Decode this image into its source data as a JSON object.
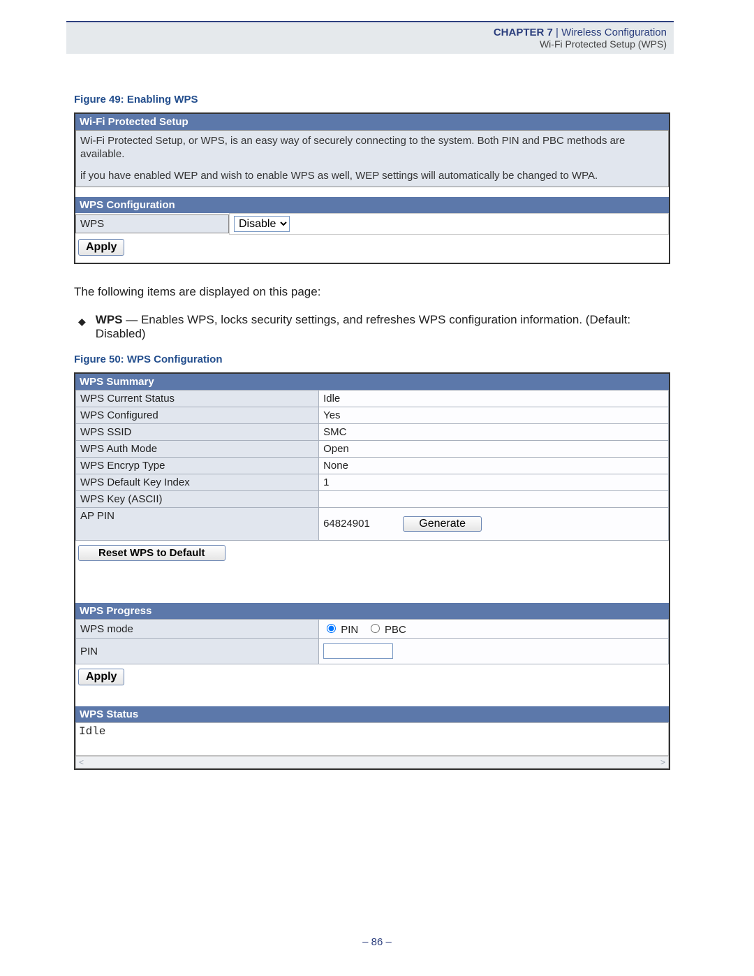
{
  "header": {
    "chapter_strong": "CHAPTER 7",
    "sep": " | ",
    "chapter_title": "Wireless Configuration",
    "subtitle": "Wi-Fi Protected Setup (WPS)"
  },
  "fig49": {
    "caption": "Figure 49:  Enabling WPS",
    "sec1_title": "Wi-Fi Protected Setup",
    "desc_p1": "Wi-Fi Protected Setup, or WPS, is an easy way of securely connecting to the system. Both PIN and PBC methods are available.",
    "desc_p2": "if you have enabled WEP and wish to enable WPS as well, WEP settings will automatically be changed to WPA.",
    "sec2_title": "WPS Configuration",
    "row_label": "WPS",
    "select_value": "Disable",
    "apply": "Apply"
  },
  "midtext": {
    "intro": "The following items are displayed on this page:",
    "bullet_term": "WPS",
    "bullet_body": " — Enables WPS, locks security settings, and refreshes WPS configuration information. (Default: Disabled)"
  },
  "fig50": {
    "caption": "Figure 50:  WPS Configuration",
    "summary_title": "WPS Summary",
    "rows": [
      {
        "label": "WPS Current Status",
        "value": "Idle"
      },
      {
        "label": "WPS Configured",
        "value": "Yes"
      },
      {
        "label": "WPS SSID",
        "value": "SMC"
      },
      {
        "label": "WPS Auth Mode",
        "value": "Open"
      },
      {
        "label": "WPS Encryp Type",
        "value": "None"
      },
      {
        "label": "WPS Default Key Index",
        "value": "1"
      },
      {
        "label": "WPS Key (ASCII)",
        "value": ""
      }
    ],
    "ap_pin_label": "AP PIN",
    "ap_pin_value": "64824901",
    "generate": "Generate",
    "reset": "Reset WPS to Default",
    "progress_title": "WPS Progress",
    "mode_label": "WPS mode",
    "mode_pin": "PIN",
    "mode_pbc": "PBC",
    "pin_label": "PIN",
    "apply": "Apply",
    "status_title": "WPS Status",
    "status_value": "Idle"
  },
  "footer": {
    "page": "–  86  –"
  }
}
